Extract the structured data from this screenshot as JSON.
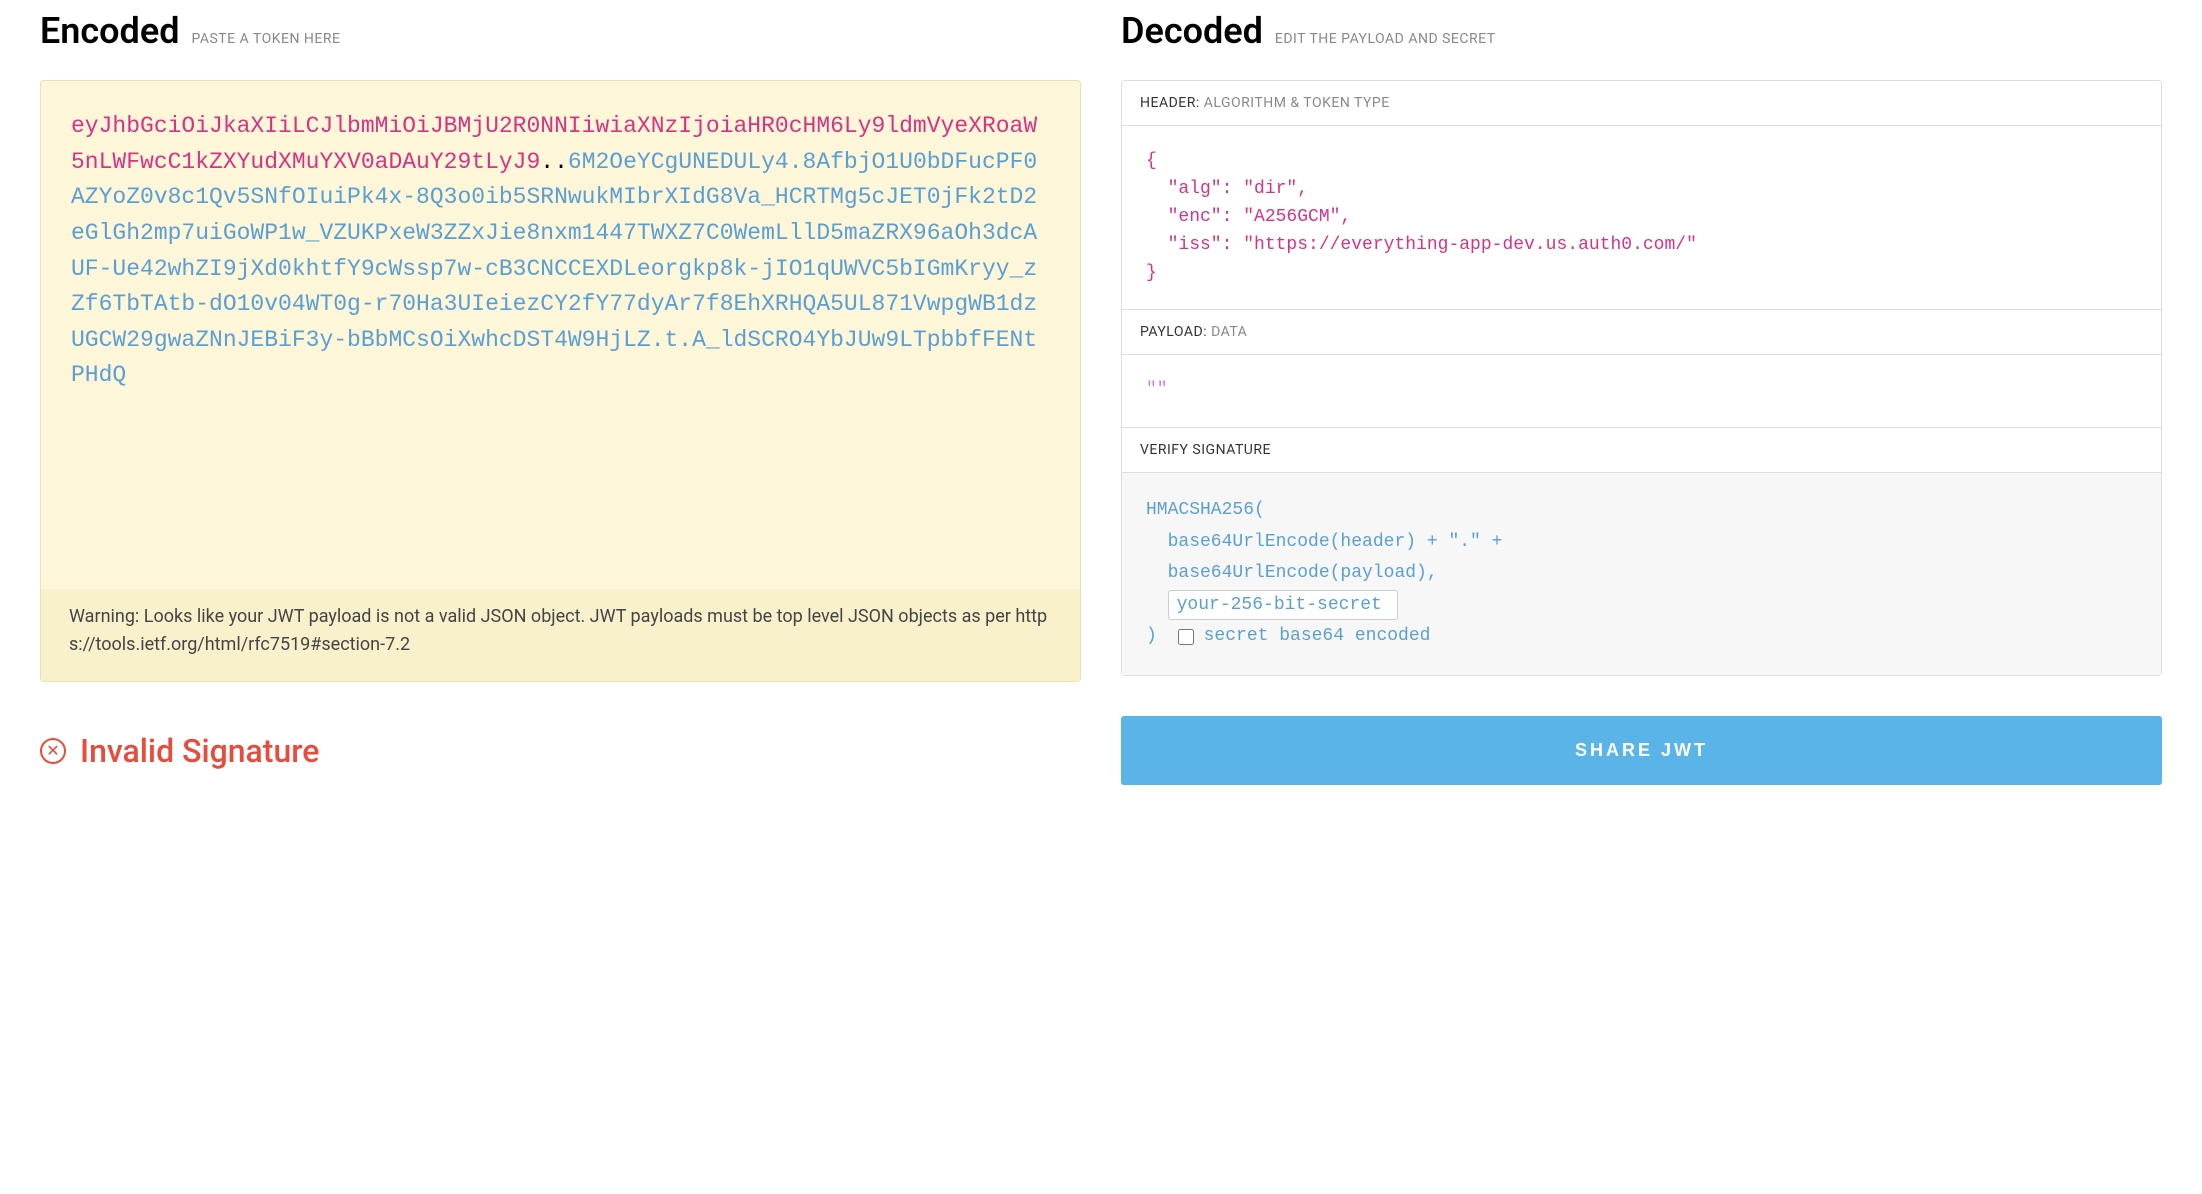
{
  "encoded": {
    "title": "Encoded",
    "subtitle": "PASTE A TOKEN HERE",
    "token_header": "eyJhbGciOiJkaXIiLCJlbmMiOiJBMjU2R0NNIiwiaXNzIjoiaHR0cHM6Ly9ldmVyeXRoaW5nLWFwcC1kZXYudXMuYXV0aDAuY29tLyJ9",
    "token_dots": "..",
    "token_payload": "6M2OeYCgUNEDULy4.8AfbjO1U0bDFucPF0AZYoZ0v8c1Qv5SNfOIuiPk4x-8Q3o0ib5SRNwukMIbrXIdG8Va_HCRTMg5cJET0jFk2tD2eGlGh2mp7uiGoWP1w_VZUKPxeW3ZZxJie8nxm1447TWXZ7C0WemLllD5maZRX96aOh3dcAUF-Ue42whZI9jXd0khtfY9cWssp7w-cB3CNCCEXDLeorgkp8k-jIO1qUWVC5bIGmKryy_zZf6TbTAtb-dO10v04WT0g-r70Ha3UIeiezCY2fY77dyAr7f8EhXRHQA5UL871VwpgWB1dzUGCW29gwaZNnJEBiF3y-bBbMCsOiXwhcDST4W9HjLZ.t.A_ldSCRO4YbJUw9LTpbbfFENtPHdQ",
    "warning": "Warning: Looks like your JWT payload is not a valid JSON object. JWT payloads must be top level JSON objects as per https://tools.ietf.org/html/rfc7519#section-7.2"
  },
  "decoded": {
    "title": "Decoded",
    "subtitle": "EDIT THE PAYLOAD AND SECRET",
    "header_section": {
      "label": "HEADER:",
      "sublabel": "ALGORITHM & TOKEN TYPE",
      "json_lines": [
        "{",
        "  \"alg\": \"dir\",",
        "  \"enc\": \"A256GCM\",",
        "  \"iss\": \"https://everything-app-dev.us.auth0.com/\"",
        "}"
      ]
    },
    "payload_section": {
      "label": "PAYLOAD:",
      "sublabel": "DATA",
      "value": "\"\""
    },
    "verify_section": {
      "label": "VERIFY SIGNATURE",
      "line1": "HMACSHA256(",
      "line2": "  base64UrlEncode(header) + \".\" +",
      "line3": "  base64UrlEncode(payload),",
      "secret_value": "your-256-bit-secret",
      "line_close": ") ",
      "checkbox_label": "secret base64 encoded"
    }
  },
  "status": {
    "text": "Invalid Signature",
    "icon_glyph": "✕"
  },
  "share": {
    "label": "SHARE JWT"
  }
}
